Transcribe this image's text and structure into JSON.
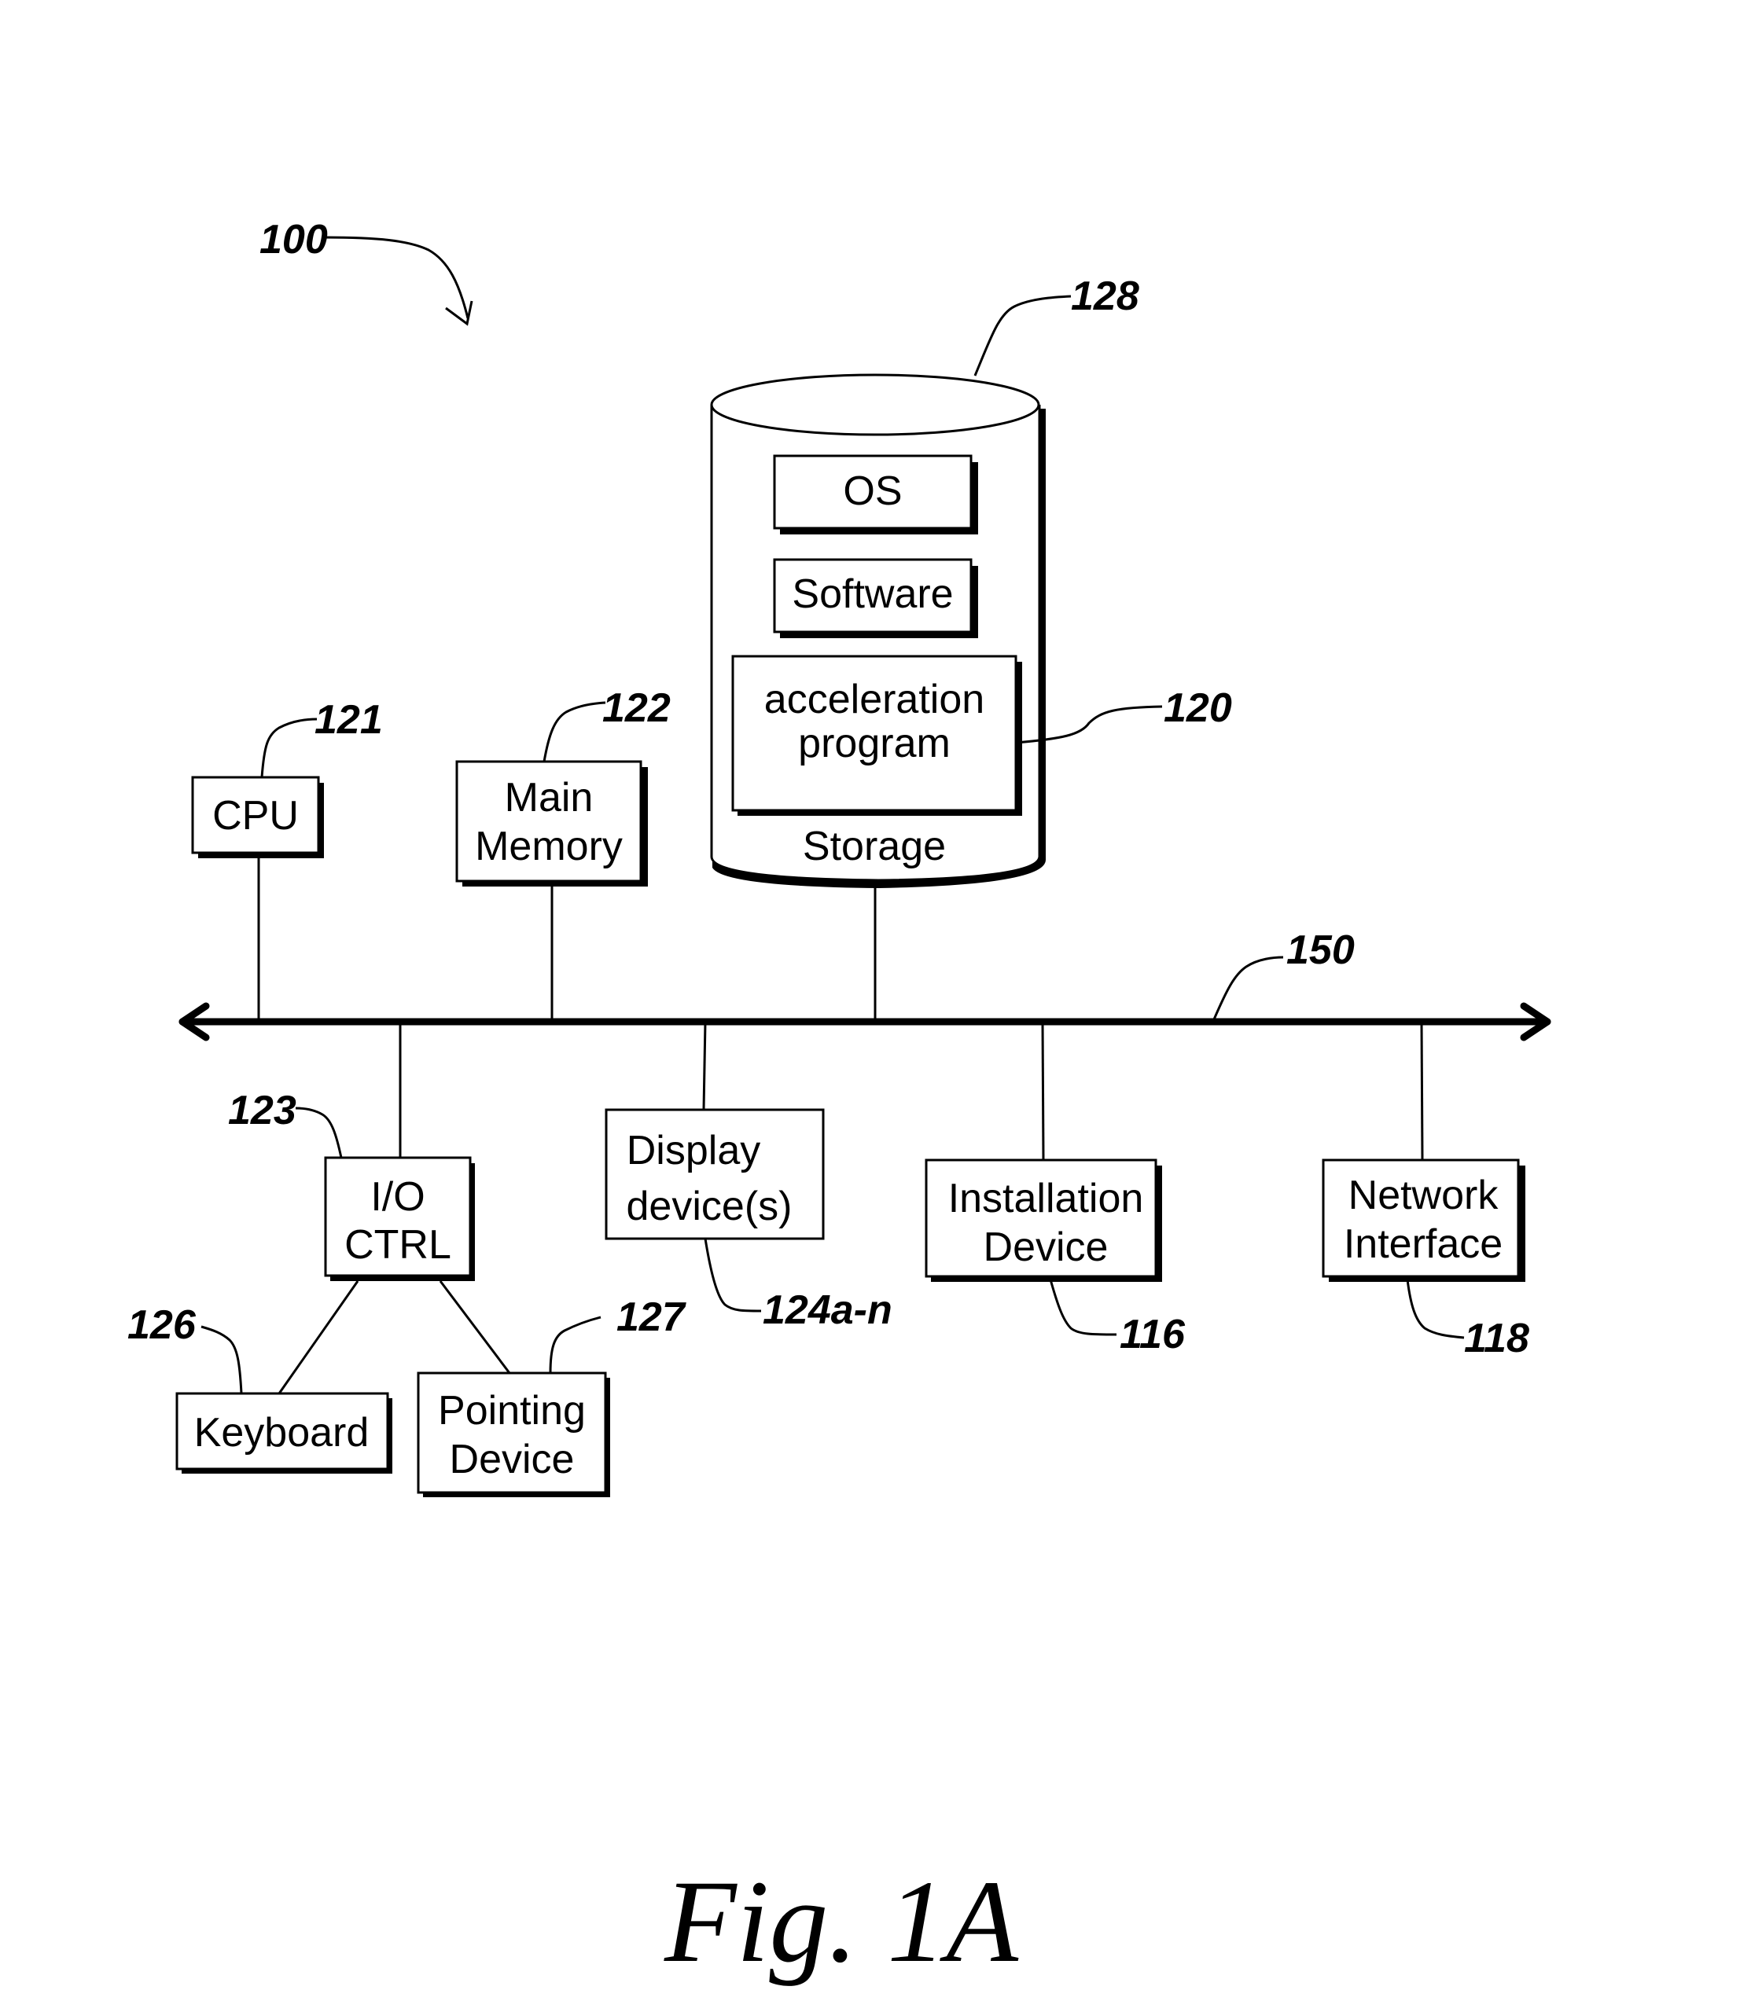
{
  "figure": {
    "caption": "Fig. 1A",
    "system_ref": "100"
  },
  "bus": {
    "ref": "150"
  },
  "storage": {
    "ref": "128",
    "label": "Storage",
    "contents": {
      "os": "OS",
      "software": "Software",
      "acceleration_line1": "acceleration",
      "acceleration_line2": "program",
      "acceleration_ref": "120"
    }
  },
  "components": {
    "cpu": {
      "label": "CPU",
      "ref": "121"
    },
    "main_memory": {
      "line1": "Main",
      "line2": "Memory",
      "ref": "122"
    },
    "io_ctrl": {
      "line1": "I/O",
      "line2": "CTRL",
      "ref": "123"
    },
    "display": {
      "line1": "Display",
      "line2": "device(s)",
      "ref": "124a-n"
    },
    "installation": {
      "line1": "Installation",
      "line2": "Device",
      "ref": "116"
    },
    "network": {
      "line1": "Network",
      "line2": "Interface",
      "ref": "118"
    },
    "keyboard": {
      "label": "Keyboard",
      "ref": "126"
    },
    "pointing": {
      "line1": "Pointing",
      "line2": "Device",
      "ref": "127"
    }
  }
}
